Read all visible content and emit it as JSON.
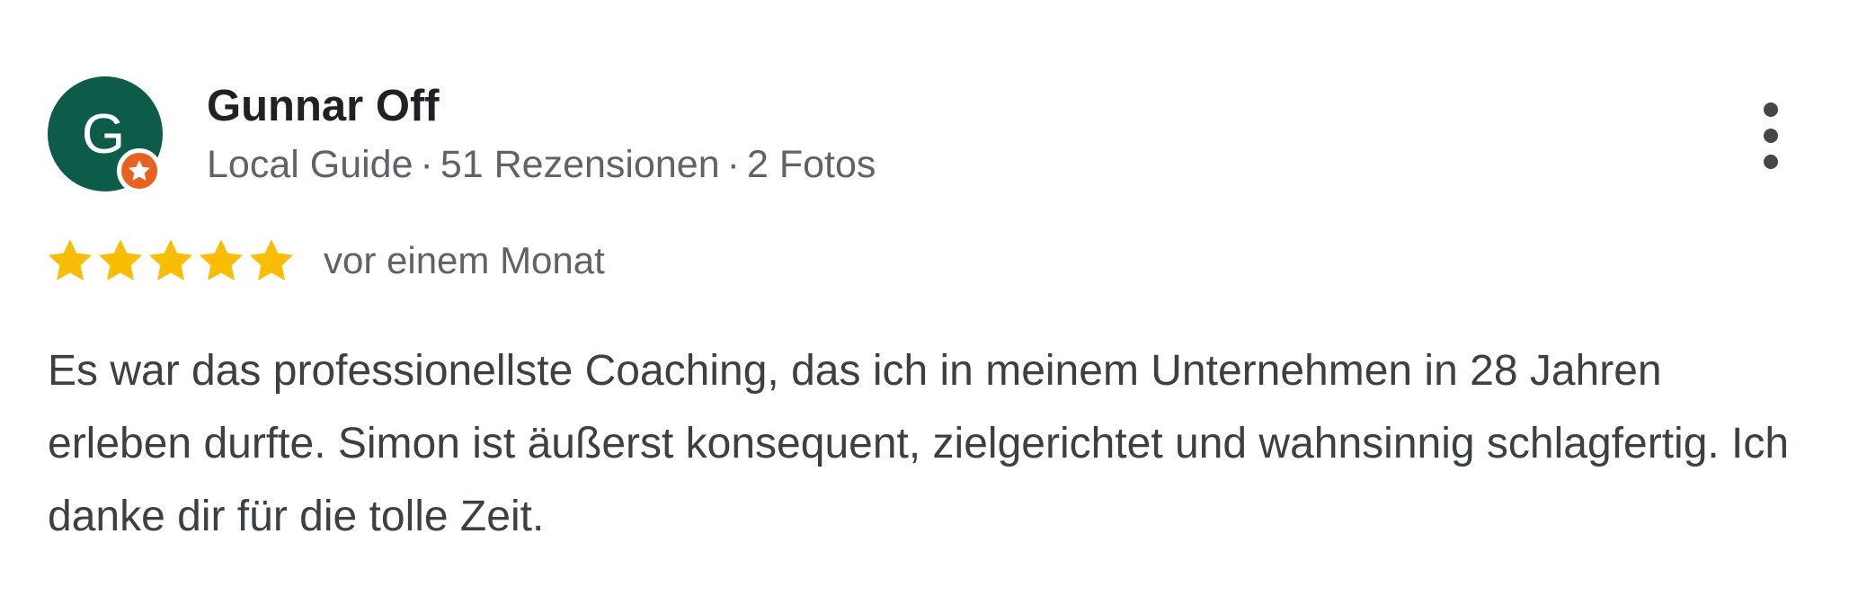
{
  "reviewer": {
    "name": "Gunnar Off",
    "initial": "G",
    "avatar_color": "#0d5c4a",
    "badge_icon": "local-guide-star-icon",
    "badge_color": "#e8621f",
    "meta": {
      "level": "Local Guide",
      "separator": "·",
      "reviews": "51 Rezensionen",
      "photos": "2 Fotos"
    }
  },
  "menu": {
    "icon": "more-vert-icon"
  },
  "rating": {
    "stars": 5,
    "max_stars": 5,
    "star_color": "#fbbc04",
    "date": "vor einem Monat"
  },
  "review": {
    "text": "Es war das professionellste Coaching, das ich in meinem Unternehmen in 28 Jahren erleben durfte. Simon ist äußerst konsequent, zielgerichtet und wahnsinnig schlagfertig. Ich danke dir für die tolle Zeit."
  }
}
